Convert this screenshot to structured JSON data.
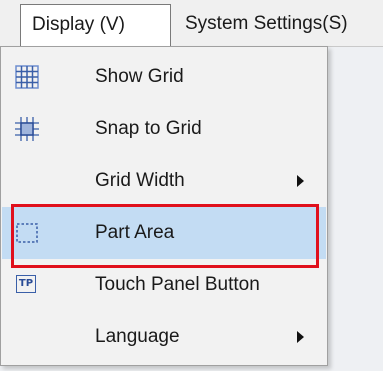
{
  "menubar": {
    "items": [
      {
        "label": "Display (V)"
      },
      {
        "label": "System Settings(S)"
      }
    ]
  },
  "menu": {
    "items": [
      {
        "label": "Show Grid",
        "icon": "grid-icon"
      },
      {
        "label": "Snap to Grid",
        "icon": "snap-grid-icon"
      },
      {
        "label": "Grid Width",
        "submenu": true
      },
      {
        "label": "Part Area",
        "icon": "part-area-icon",
        "highlighted": true,
        "annotated": true
      },
      {
        "label": "Touch Panel Button",
        "icon": "touch-panel-icon",
        "icon_text": "TP"
      },
      {
        "label": "Language",
        "submenu": true
      }
    ]
  },
  "colors": {
    "highlight": "#c3dcf3",
    "annotation_frame": "#e0101c",
    "icon_blue": "#3a5fa8"
  }
}
